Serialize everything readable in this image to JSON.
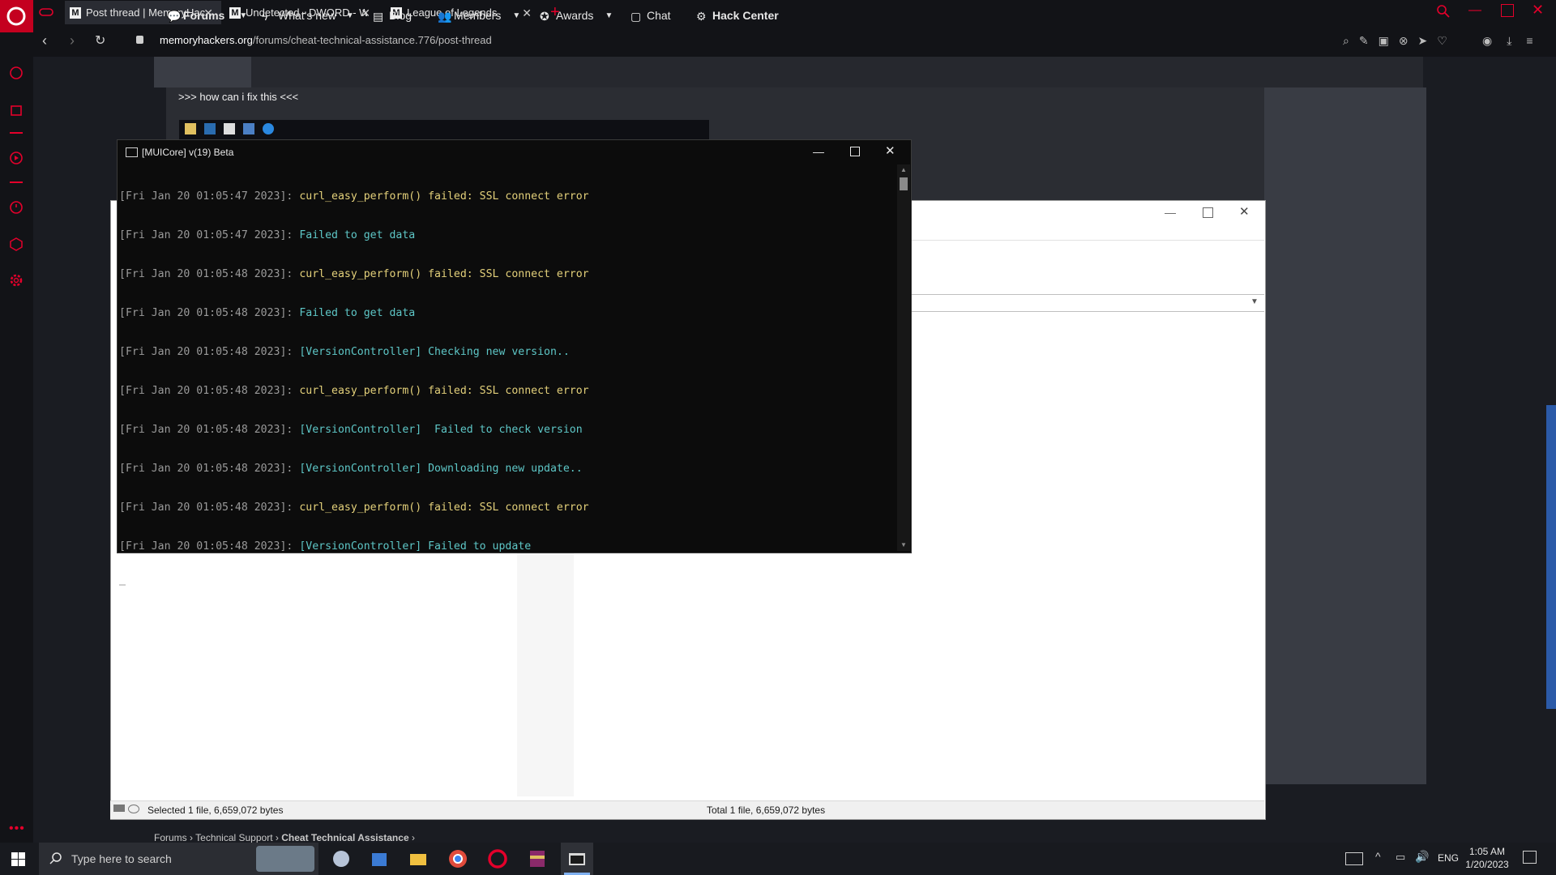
{
  "browser": {
    "tabs": [
      {
        "favicon": "M",
        "title": "Post thread | MemoryHack",
        "active": true
      },
      {
        "favicon": "M",
        "title": "Undetected - DWORD - W",
        "active": false
      },
      {
        "favicon": "M",
        "title": "League of Legends",
        "active": false
      }
    ],
    "url_host": "memoryhackers.org",
    "url_path": "/forums/cheat-technical-assistance.776/post-thread"
  },
  "forum_nav": {
    "items": [
      {
        "label": "Forums",
        "icon": "chat-bubbles-icon"
      },
      {
        "label": "What's new",
        "icon": "bolt-icon"
      },
      {
        "label": "Blog",
        "icon": "newspaper-icon"
      },
      {
        "label": "Members",
        "icon": "users-icon"
      },
      {
        "label": "Awards",
        "icon": "award-icon"
      },
      {
        "label": "Chat",
        "icon": "chat-icon"
      },
      {
        "label": "Hack Center",
        "icon": "gear-icon"
      }
    ]
  },
  "post": {
    "text": ">>> how can i fix this <<<"
  },
  "console": {
    "title": "[MUICore] v(19) Beta",
    "lines": [
      {
        "ts": "[Fri Jan 20 01:05:47 2023]:",
        "msg": "curl_easy_perform() failed: SSL connect error",
        "color": "yellow"
      },
      {
        "ts": "[Fri Jan 20 01:05:47 2023]:",
        "msg": "Failed to get data",
        "color": "cyan"
      },
      {
        "ts": "[Fri Jan 20 01:05:48 2023]:",
        "msg": "curl_easy_perform() failed: SSL connect error",
        "color": "yellow"
      },
      {
        "ts": "[Fri Jan 20 01:05:48 2023]:",
        "msg": "Failed to get data",
        "color": "cyan"
      },
      {
        "ts": "[Fri Jan 20 01:05:48 2023]:",
        "msg": "[VersionController] Checking new version..",
        "color": "cyan"
      },
      {
        "ts": "[Fri Jan 20 01:05:48 2023]:",
        "msg": "curl_easy_perform() failed: SSL connect error",
        "color": "yellow"
      },
      {
        "ts": "[Fri Jan 20 01:05:48 2023]:",
        "msg": "[VersionController]  Failed to check version",
        "color": "cyan"
      },
      {
        "ts": "[Fri Jan 20 01:05:48 2023]:",
        "msg": "[VersionController] Downloading new update..",
        "color": "cyan"
      },
      {
        "ts": "[Fri Jan 20 01:05:48 2023]:",
        "msg": "curl_easy_perform() failed: SSL connect error",
        "color": "yellow"
      },
      {
        "ts": "[Fri Jan 20 01:05:48 2023]:",
        "msg": "[VersionController] Failed to update",
        "color": "cyan"
      }
    ]
  },
  "explorer": {
    "status_left": "Selected 1 file, 6,659,072 bytes",
    "status_right": "Total 1 file, 6,659,072 bytes"
  },
  "breadcrumb": {
    "items": [
      "Forums",
      "Technical Support",
      "Cheat Technical Assistance"
    ]
  },
  "taskbar": {
    "search_placeholder": "Type here to search",
    "language": "ENG",
    "time": "1:05 AM",
    "date": "1/20/2023"
  },
  "colors": {
    "accent": "#e4002b",
    "console_yellow": "#e3d07a",
    "console_cyan": "#5ec7c7"
  }
}
